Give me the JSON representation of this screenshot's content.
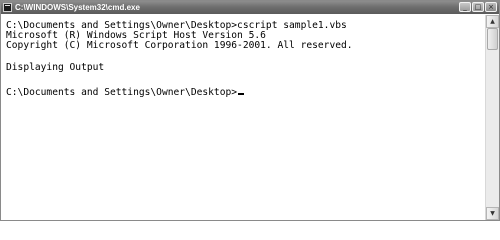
{
  "window": {
    "title": "C:\\WINDOWS\\System32\\cmd.exe",
    "icon": "console-icon"
  },
  "titlebar_buttons": {
    "minimize": "_",
    "maximize": "□",
    "close": "×"
  },
  "console": {
    "lines": [
      "C:\\Documents and Settings\\Owner\\Desktop>cscript sample1.vbs",
      "Microsoft (R) Windows Script Host Version 5.6",
      "Copyright (C) Microsoft Corporation 1996-2001. All reserved.",
      "Displaying Output",
      "",
      "C:\\Documents and Settings\\Owner\\Desktop>"
    ]
  },
  "scrollbar": {
    "up_arrow": "▲",
    "down_arrow": "▼"
  }
}
